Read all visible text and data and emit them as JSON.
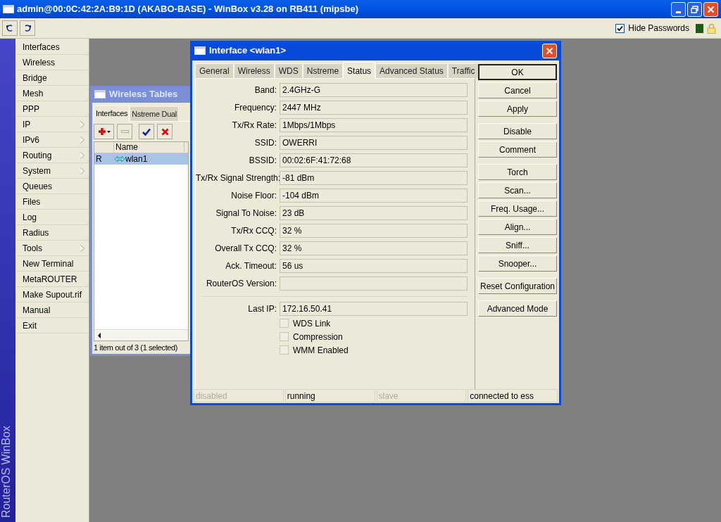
{
  "window": {
    "title": "admin@00:0C:42:2A:B9:1D (AKABO-BASE) - WinBox v3.28 on RB411 (mipsbe)"
  },
  "toolbar": {
    "hide_passwords": {
      "label": "Hide Passwords",
      "checked": true
    }
  },
  "brand": "RouterOS WinBox",
  "menu": [
    {
      "label": "Interfaces",
      "submenu": false
    },
    {
      "label": "Wireless",
      "submenu": false
    },
    {
      "label": "Bridge",
      "submenu": false
    },
    {
      "label": "Mesh",
      "submenu": false
    },
    {
      "label": "PPP",
      "submenu": false
    },
    {
      "label": "IP",
      "submenu": true
    },
    {
      "label": "IPv6",
      "submenu": true
    },
    {
      "label": "Routing",
      "submenu": true
    },
    {
      "label": "System",
      "submenu": true
    },
    {
      "label": "Queues",
      "submenu": false
    },
    {
      "label": "Files",
      "submenu": false
    },
    {
      "label": "Log",
      "submenu": false
    },
    {
      "label": "Radius",
      "submenu": false
    },
    {
      "label": "Tools",
      "submenu": true
    },
    {
      "label": "New Terminal",
      "submenu": false
    },
    {
      "label": "MetaROUTER",
      "submenu": false
    },
    {
      "label": "Make Supout.rif",
      "submenu": false
    },
    {
      "label": "Manual",
      "submenu": false
    },
    {
      "label": "Exit",
      "submenu": false
    }
  ],
  "wireless_tables": {
    "title": "Wireless Tables",
    "tabs": [
      {
        "label": "Interfaces",
        "selected": true
      },
      {
        "label": "Nstreme Dual",
        "selected": false
      }
    ],
    "table": {
      "columns": [
        "Name"
      ],
      "rows": [
        {
          "flag": "R",
          "name": "wlan1",
          "selected": true
        }
      ]
    },
    "status": "1 item out of 3 (1 selected)"
  },
  "interface_window": {
    "title": "Interface <wlan1>",
    "tabs": [
      {
        "label": "General",
        "selected": false
      },
      {
        "label": "Wireless",
        "selected": false
      },
      {
        "label": "WDS",
        "selected": false
      },
      {
        "label": "Nstreme",
        "selected": false
      },
      {
        "label": "Status",
        "selected": true
      },
      {
        "label": "Advanced Status",
        "selected": false
      },
      {
        "label": "Traffic",
        "selected": false
      }
    ],
    "fields": [
      {
        "label": "Band:",
        "value": "2.4GHz-G"
      },
      {
        "label": "Frequency:",
        "value": "2447 MHz"
      },
      {
        "label": "Tx/Rx Rate:",
        "value": "1Mbps/1Mbps"
      },
      {
        "label": "SSID:",
        "value": "OWERRI"
      },
      {
        "label": "BSSID:",
        "value": "00:02:6F:41:72:68"
      },
      {
        "label": "Tx/Rx Signal Strength:",
        "value": "-81 dBm"
      },
      {
        "label": "Noise Floor:",
        "value": "-104 dBm"
      },
      {
        "label": "Signal To Noise:",
        "value": "23 dB"
      },
      {
        "label": "Tx/Rx CCQ:",
        "value": "32 %"
      },
      {
        "label": "Overall Tx CCQ:",
        "value": "32 %"
      },
      {
        "label": "Ack. Timeout:",
        "value": "56 us"
      },
      {
        "label": "RouterOS Version:"
      }
    ],
    "extra_fields": [
      {
        "label": "Last IP:",
        "value": "172.16.50.41"
      }
    ],
    "checkboxes": [
      {
        "label": "WDS Link",
        "checked": false
      },
      {
        "label": "Compression",
        "checked": false
      },
      {
        "label": "WMM Enabled",
        "checked": false
      }
    ],
    "button_groups": [
      [
        {
          "label": "OK",
          "default": true
        },
        {
          "label": "Cancel",
          "default": false
        },
        {
          "label": "Apply",
          "default": false
        }
      ],
      [
        {
          "label": "Disable",
          "default": false
        },
        {
          "label": "Comment",
          "default": false
        }
      ],
      [
        {
          "label": "Torch",
          "default": false
        },
        {
          "label": "Scan...",
          "default": false
        },
        {
          "label": "Freq. Usage...",
          "default": false
        },
        {
          "label": "Align...",
          "default": false
        },
        {
          "label": "Sniff...",
          "default": false
        },
        {
          "label": "Snooper...",
          "default": false
        }
      ],
      [
        {
          "label": "Reset Configuration",
          "default": false
        }
      ],
      [
        {
          "label": "Advanced Mode",
          "default": false
        }
      ]
    ],
    "status_bar": [
      {
        "text": "disabled",
        "active": false
      },
      {
        "text": "running",
        "active": true
      },
      {
        "text": "slave",
        "active": false
      },
      {
        "text": "connected to ess",
        "active": true
      }
    ]
  }
}
